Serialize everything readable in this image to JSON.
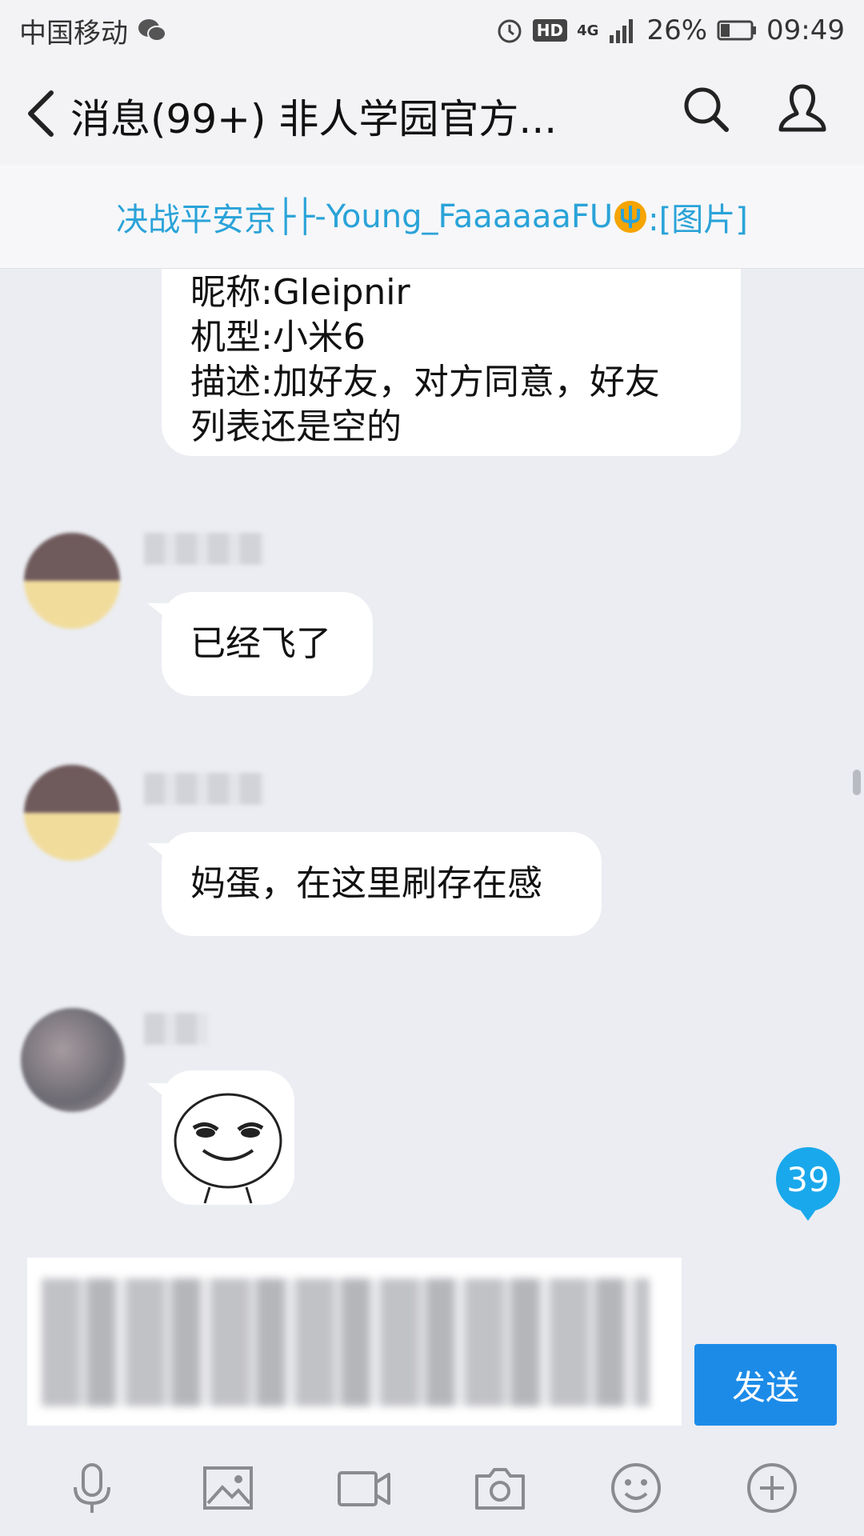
{
  "status_bar": {
    "carrier": "中国移动",
    "network": "4G",
    "battery": "26%",
    "time": "09:49"
  },
  "header": {
    "title": "消息(99+)  非人学园官方..."
  },
  "notice": {
    "prefix": "决战平安京",
    "sender": "Young_FaaaaaaFU",
    "suffix": ":[图片]"
  },
  "messages": [
    {
      "lines": [
        "昵称:Gleipnir",
        "机型:小米6",
        "描述:加好友，对方同意，好友",
        "列表还是空的"
      ]
    },
    {
      "text": "已经飞了"
    },
    {
      "text": "妈蛋，在这里刷存在感"
    },
    {
      "type": "sticker",
      "icon": "smirk-face-sticker"
    }
  ],
  "unread_count": "39",
  "input": {
    "send_label": "发送"
  },
  "toolbar": {
    "icons": [
      "microphone-icon",
      "image-icon",
      "video-icon",
      "camera-icon",
      "emoji-icon",
      "plus-icon"
    ]
  }
}
